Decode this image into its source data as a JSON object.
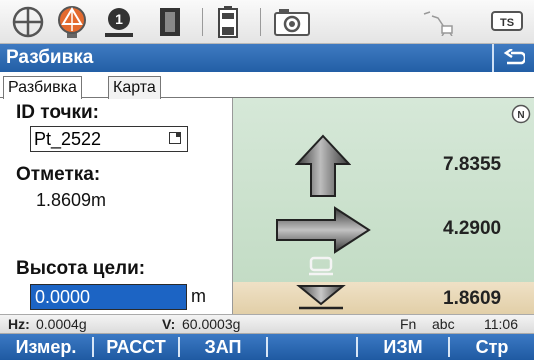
{
  "titlebar": {
    "title": "Разбивка"
  },
  "tabs": [
    {
      "label": "Разбивка"
    },
    {
      "label": "Карта"
    }
  ],
  "form": {
    "point_id_label": "ID точки:",
    "point_id_value": "Pt_2522",
    "elevation_label": "Отметка:",
    "elevation_value": "1.8609m",
    "target_height_label": "Высота цели:",
    "target_height_value": "0.0000",
    "target_height_unit": "m"
  },
  "panel": {
    "badge": "N",
    "forward_value": "7.8355",
    "side_value": "4.2900",
    "height_value": "1.8609"
  },
  "infobar": {
    "hz_label": "Hz:",
    "hz_value": "0.0004g",
    "v_label": "V:",
    "v_value": "60.0003g",
    "fn": "Fn",
    "input_mode": "abc",
    "time": "11:06"
  },
  "softkeys": [
    "Измер.",
    "РАССТ",
    "ЗАП",
    "ИЗМ",
    "Стр"
  ],
  "status_icons": [
    "target-crosshair-icon",
    "prism-icon",
    "reflector-1-icon",
    "laser-pointer-icon",
    "battery-icon",
    "camera-icon",
    "connection-icon",
    "ts-badge-icon"
  ],
  "status_text": {
    "reflector_number": "1",
    "ts_badge": "TS"
  },
  "colors": {
    "title_blue": "#235fa6",
    "panel_green": "#c3dcc5",
    "panel_sand": "#e2cfa8",
    "selection_blue": "#1c64c4"
  }
}
